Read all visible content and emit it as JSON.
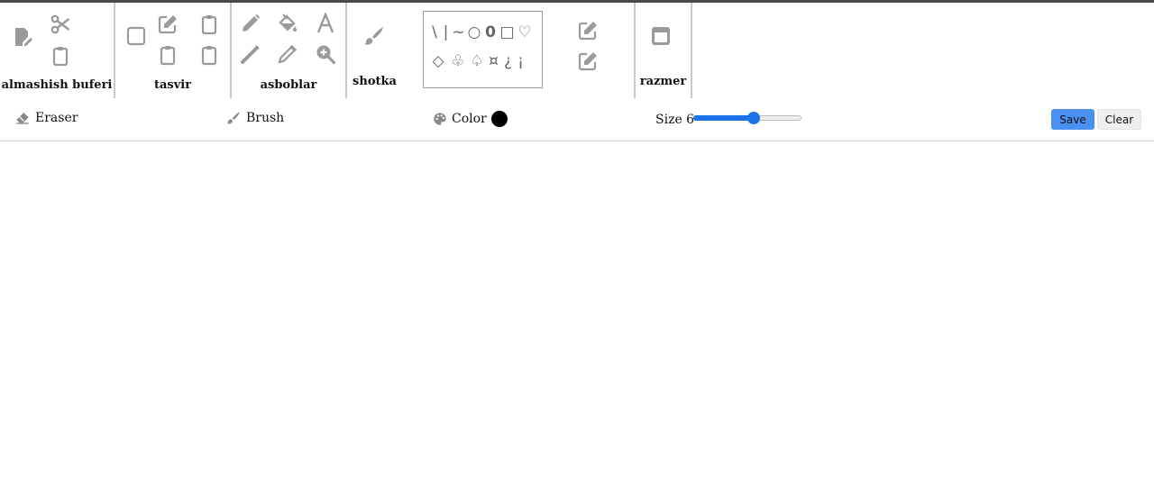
{
  "ribbon": {
    "groups": {
      "clipboard": {
        "label": "almashish buferi"
      },
      "image": {
        "label": "tasvir"
      },
      "tools": {
        "label": "asboblar"
      },
      "brushes": {
        "label": "shotka"
      },
      "size": {
        "label": "razmer"
      }
    },
    "shapes": {
      "row1": [
        "\\",
        "|",
        "~",
        "○",
        "0",
        "□",
        "♡"
      ],
      "row2": [
        "◇",
        "♧",
        "♤",
        "¤",
        "¿",
        "¡"
      ]
    }
  },
  "toolbar": {
    "eraser_label": "Eraser",
    "brush_label": "Brush",
    "color_label": "Color",
    "size_label": "Size 6",
    "size_value": 6,
    "size_min": 1,
    "size_max": 10,
    "save_label": "Save",
    "clear_label": "Clear"
  },
  "colors": {
    "icon": "#9a9a9a",
    "accent": "#1a73e8",
    "save_button": "#4a90f0",
    "current_color": "#000000"
  }
}
